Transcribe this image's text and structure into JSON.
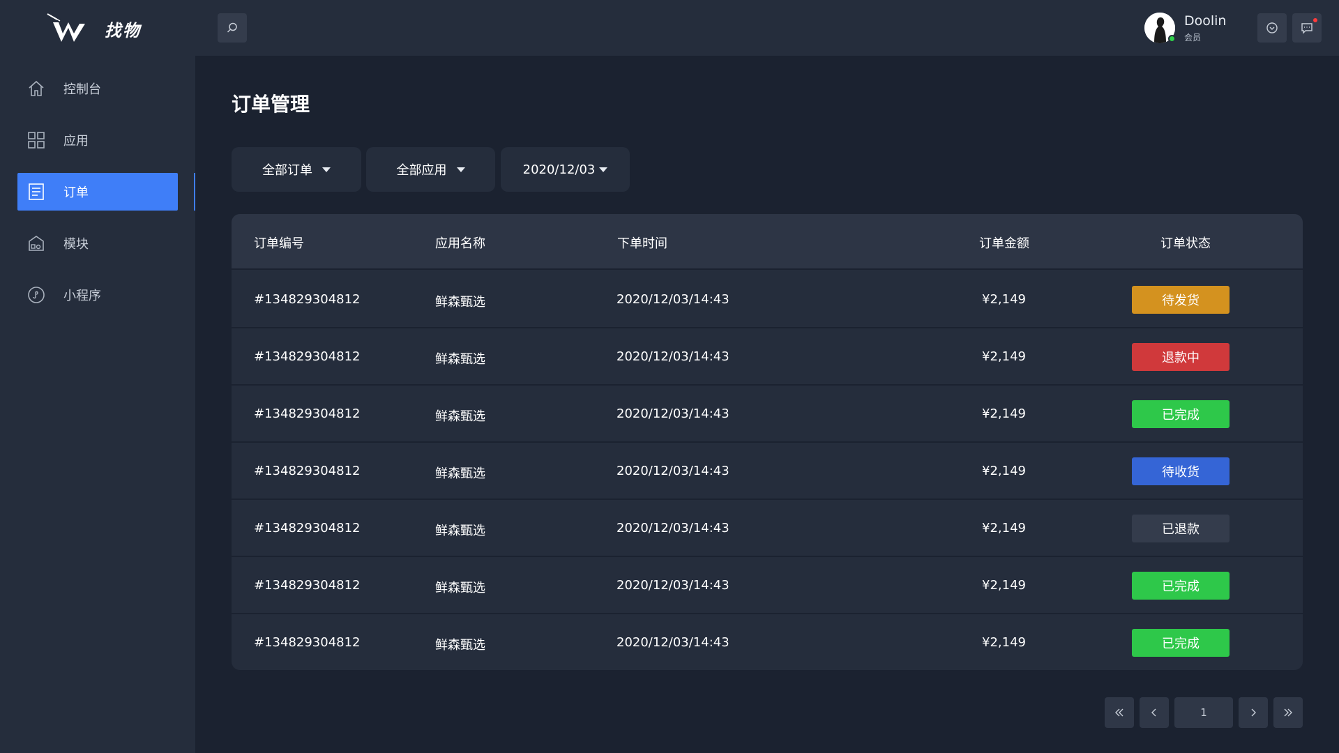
{
  "header": {
    "logo_text": "找物",
    "user": {
      "name": "Doolin",
      "role": "会员"
    },
    "icons": {
      "search": "search-icon",
      "dropdown": "chevron-circle-icon",
      "messages": "message-icon"
    }
  },
  "sidebar": {
    "items": [
      {
        "label": "控制台",
        "icon": "home-icon"
      },
      {
        "label": "应用",
        "icon": "apps-grid-icon"
      },
      {
        "label": "订单",
        "icon": "order-list-icon",
        "active": true
      },
      {
        "label": "模块",
        "icon": "module-icon"
      },
      {
        "label": "小程序",
        "icon": "mini-program-icon"
      }
    ]
  },
  "main": {
    "title": "订单管理",
    "filters": {
      "order_type": "全部订单",
      "app": "全部应用",
      "date": "2020/12/03"
    },
    "table": {
      "columns": [
        "订单编号",
        "应用名称",
        "下单时间",
        "订单金额",
        "订单状态"
      ],
      "rows": [
        {
          "id": "#134829304812",
          "app": "鲜森甄选",
          "time": "2020/12/03/14:43",
          "amount": "¥2,149",
          "status": "待发货",
          "status_color": "#d4921f"
        },
        {
          "id": "#134829304812",
          "app": "鲜森甄选",
          "time": "2020/12/03/14:43",
          "amount": "¥2,149",
          "status": "退款中",
          "status_color": "#d0393b"
        },
        {
          "id": "#134829304812",
          "app": "鲜森甄选",
          "time": "2020/12/03/14:43",
          "amount": "¥2,149",
          "status": "已完成",
          "status_color": "#2ec84a"
        },
        {
          "id": "#134829304812",
          "app": "鲜森甄选",
          "time": "2020/12/03/14:43",
          "amount": "¥2,149",
          "status": "待收货",
          "status_color": "#3565d6"
        },
        {
          "id": "#134829304812",
          "app": "鲜森甄选",
          "time": "2020/12/03/14:43",
          "amount": "¥2,149",
          "status": "已退款",
          "status_color": "#343c4c"
        },
        {
          "id": "#134829304812",
          "app": "鲜森甄选",
          "time": "2020/12/03/14:43",
          "amount": "¥2,149",
          "status": "已完成",
          "status_color": "#2ec84a"
        },
        {
          "id": "#134829304812",
          "app": "鲜森甄选",
          "time": "2020/12/03/14:43",
          "amount": "¥2,149",
          "status": "已完成",
          "status_color": "#2ec84a"
        }
      ]
    },
    "pagination": {
      "current_page": "1"
    }
  },
  "colors": {
    "accent": "#3f7ef8",
    "background": "#1b2230",
    "panel": "#252d3c"
  }
}
